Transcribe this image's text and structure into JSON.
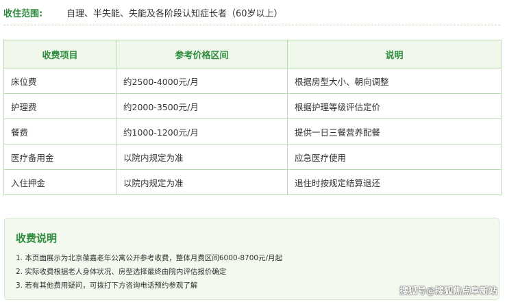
{
  "admission": {
    "label": "收住范围:",
    "value": "自理、半失能、失能及各阶段认知症长者（60岁以上）"
  },
  "fee_table": {
    "headers": [
      "收费项目",
      "参考价格区间",
      "说明"
    ],
    "rows": [
      [
        "床位费",
        "约2500-4000元/月",
        "根据房型大小、朝向调整"
      ],
      [
        "护理费",
        "约2000-3500元/月",
        "根据护理等级评估定价"
      ],
      [
        "餐费",
        "约1000-1200元/月",
        "提供一日三餐营养配餐"
      ],
      [
        "医疗备用金",
        "以院内规定为准",
        "应急医疗使用"
      ],
      [
        "入住押金",
        "以院内规定为准",
        "退住时按规定结算退还"
      ]
    ]
  },
  "notes": {
    "title": "收费说明",
    "items": [
      "1. 本页面展示为北京葆嘉老年公寓公开参考收费，整体月费区间6000-8700元/月起",
      "2. 实际收费根据老人身体状况、房型选择最终由院内评估报价确定",
      "3. 若有其他费用疑问，可拨打下方咨询电话预约参观了解"
    ]
  },
  "watermark": "搜狐号@搜狐焦点阜新站",
  "colors": {
    "accent_green": "#2e8b3e",
    "header_bg": "#eef7ea",
    "border_green": "#b9dbb1",
    "notes_bg": "#f3f9ee"
  }
}
